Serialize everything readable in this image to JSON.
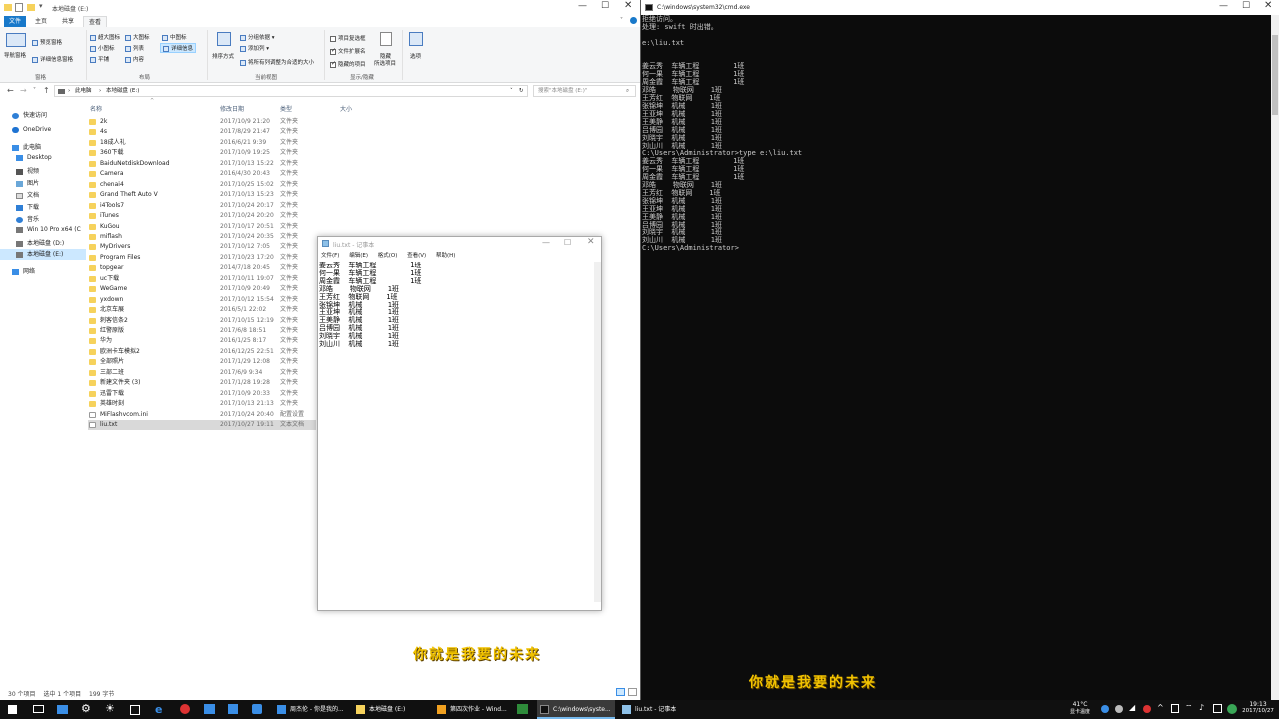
{
  "explorer": {
    "title": "本地磁盘 (E:)",
    "tabs": [
      "文件",
      "主页",
      "共享",
      "查看"
    ],
    "ribbon": {
      "pane": {
        "nav": "导航窗格",
        "preview": "预览窗格",
        "details": "详细信息窗格",
        "group": "窗格"
      },
      "layout": {
        "xl": "超大图标",
        "l": "大图标",
        "m": "中图标",
        "s": "小图标",
        "list": "列表",
        "detail": "详细信息",
        "tile": "平铺",
        "content": "内容",
        "group": "布局"
      },
      "view": {
        "sort": "排序方式",
        "groupby": "分组依据",
        "addcol": "添加列",
        "fit": "将所有列调整为合适的大小",
        "group": "当前视图"
      },
      "show": {
        "cb": "项目复选框",
        "ext": "文件扩展名",
        "hidden": "隐藏的项目",
        "hide": "隐藏",
        "hide2": "所选项目",
        "group": "显示/隐藏"
      },
      "options": "选项"
    },
    "address": {
      "pc": "此电脑",
      "drive": "本地磁盘 (E:)"
    },
    "search_placeholder": "搜索\"本地磁盘 (E:)\"",
    "columns": {
      "name": "名称",
      "date": "修改日期",
      "type": "类型",
      "size": "大小"
    },
    "nav": {
      "quick": "快速访问",
      "onedrive": "OneDrive",
      "pc": "此电脑",
      "desktop": "Desktop",
      "video": "视频",
      "pictures": "图片",
      "docs": "文档",
      "downloads": "下载",
      "music": "音乐",
      "c": "Win 10 Pro x64 (C",
      "d": "本地磁盘 (D:)",
      "e": "本地磁盘 (E:)",
      "network": "网络"
    },
    "files": [
      {
        "name": "2k",
        "date": "2017/10/9 21:20",
        "type": "文件夹"
      },
      {
        "name": "4s",
        "date": "2017/8/29 21:47",
        "type": "文件夹"
      },
      {
        "name": "18成人礼",
        "date": "2016/6/21 9:39",
        "type": "文件夹"
      },
      {
        "name": "360下载",
        "date": "2017/10/9 19:25",
        "type": "文件夹"
      },
      {
        "name": "BaiduNetdiskDownload",
        "date": "2017/10/13 15:22",
        "type": "文件夹"
      },
      {
        "name": "Camera",
        "date": "2016/4/30 20:43",
        "type": "文件夹"
      },
      {
        "name": "chenai4",
        "date": "2017/10/25 15:02",
        "type": "文件夹"
      },
      {
        "name": "Grand Theft Auto V",
        "date": "2017/10/13 15:23",
        "type": "文件夹"
      },
      {
        "name": "i4Tools7",
        "date": "2017/10/24 20:17",
        "type": "文件夹"
      },
      {
        "name": "iTunes",
        "date": "2017/10/24 20:20",
        "type": "文件夹"
      },
      {
        "name": "KuGou",
        "date": "2017/10/17 20:51",
        "type": "文件夹"
      },
      {
        "name": "miflash",
        "date": "2017/10/24 20:35",
        "type": "文件夹"
      },
      {
        "name": "MyDrivers",
        "date": "2017/10/12 7:05",
        "type": "文件夹"
      },
      {
        "name": "Program Files",
        "date": "2017/10/23 17:20",
        "type": "文件夹"
      },
      {
        "name": "topgear",
        "date": "2014/7/18 20:45",
        "type": "文件夹"
      },
      {
        "name": "uc下载",
        "date": "2017/10/11 19:07",
        "type": "文件夹"
      },
      {
        "name": "WeGame",
        "date": "2017/10/9 20:49",
        "type": "文件夹"
      },
      {
        "name": "yxdown",
        "date": "2017/10/12 15:54",
        "type": "文件夹"
      },
      {
        "name": "北京车展",
        "date": "2016/5/1 22:02",
        "type": "文件夹"
      },
      {
        "name": "刺客信条2",
        "date": "2017/10/15 12:19",
        "type": "文件夹"
      },
      {
        "name": "红警原版",
        "date": "2017/6/8 18:51",
        "type": "文件夹"
      },
      {
        "name": "华为",
        "date": "2016/1/25 8:17",
        "type": "文件夹"
      },
      {
        "name": "欧洲卡车模拟2",
        "date": "2016/12/25 22:51",
        "type": "文件夹"
      },
      {
        "name": "全部照片",
        "date": "2017/1/29 12:08",
        "type": "文件夹"
      },
      {
        "name": "三部二班",
        "date": "2017/6/9 9:34",
        "type": "文件夹"
      },
      {
        "name": "新建文件夹 (3)",
        "date": "2017/1/28 19:28",
        "type": "文件夹"
      },
      {
        "name": "迅雷下载",
        "date": "2017/10/9 20:33",
        "type": "文件夹"
      },
      {
        "name": "英雄时刻",
        "date": "2017/10/13 21:13",
        "type": "文件夹"
      },
      {
        "name": "MiFlashvcom.ini",
        "date": "2017/10/24 20:40",
        "type": "配置设置"
      },
      {
        "name": "liu.txt",
        "date": "2017/10/27 19:11",
        "type": "文本文档"
      }
    ],
    "status": {
      "count": "30 个项目",
      "selected": "选中 1 个项目",
      "size": "199 字节"
    }
  },
  "notepad": {
    "title": "liu.txt - 记事本",
    "menu": [
      "文件(F)",
      "编辑(E)",
      "格式(O)",
      "查看(V)",
      "帮助(H)"
    ],
    "content": "姜云秀  车辆工程        1班\n何一果  车辆工程        1班\n周金霞  车辆工程        1班\n邓皓    物联网    1班\n王芳红  物联网    1班\n张锦坤  机械      1班\n王亚坤  机械      1班\n王美静  机械      1班\n吕博园  机械      1班\n刘晓宇  机械      1班\n刘山川  机械      1班"
  },
  "cmd": {
    "title": "C:\\windows\\system32\\cmd.exe",
    "content": "拒绝访问。\n处理: swift 时出错。\n\ne:\\liu.txt\n\n\n姜云秀  车辆工程        1班\n何一果  车辆工程        1班\n周金霞  车辆工程        1班\n邓皓    物联网    1班\n王芳红  物联网    1班\n张锦坤  机械      1班\n王亚坤  机械      1班\n王美静  机械      1班\n吕博园  机械      1班\n刘晓宇  机械      1班\n刘山川  机械      1班\nC:\\Users\\Administrator>type e:\\liu.txt\n姜云秀  车辆工程        1班\n何一果  车辆工程        1班\n周金霞  车辆工程        1班\n邓皓    物联网    1班\n王芳红  物联网    1班\n张锦坤  机械      1班\n王亚坤  机械      1班\n王美静  机械      1班\n吕博园  机械      1班\n刘晓宇  机械      1班\n刘山川  机械      1班\nC:\\Users\\Administrator>"
  },
  "subtitle": "你就是我要的未来",
  "taskbar": {
    "apps": [
      {
        "label": "周杰伦 - 你是我的...",
        "icon": "music-icon"
      },
      {
        "label": "本地磁盘 (E:)",
        "icon": "folder-icon"
      },
      {
        "label": "第四次作业 - Wind...",
        "icon": "word-icon"
      },
      {
        "label": "C:\\windows\\syste...",
        "icon": "cmd-icon"
      },
      {
        "label": "liu.txt - 记事本",
        "icon": "notepad-icon"
      }
    ],
    "weather": "41°C",
    "weather2": "显卡温度",
    "time": "19:13",
    "date": "2017/10/27"
  }
}
